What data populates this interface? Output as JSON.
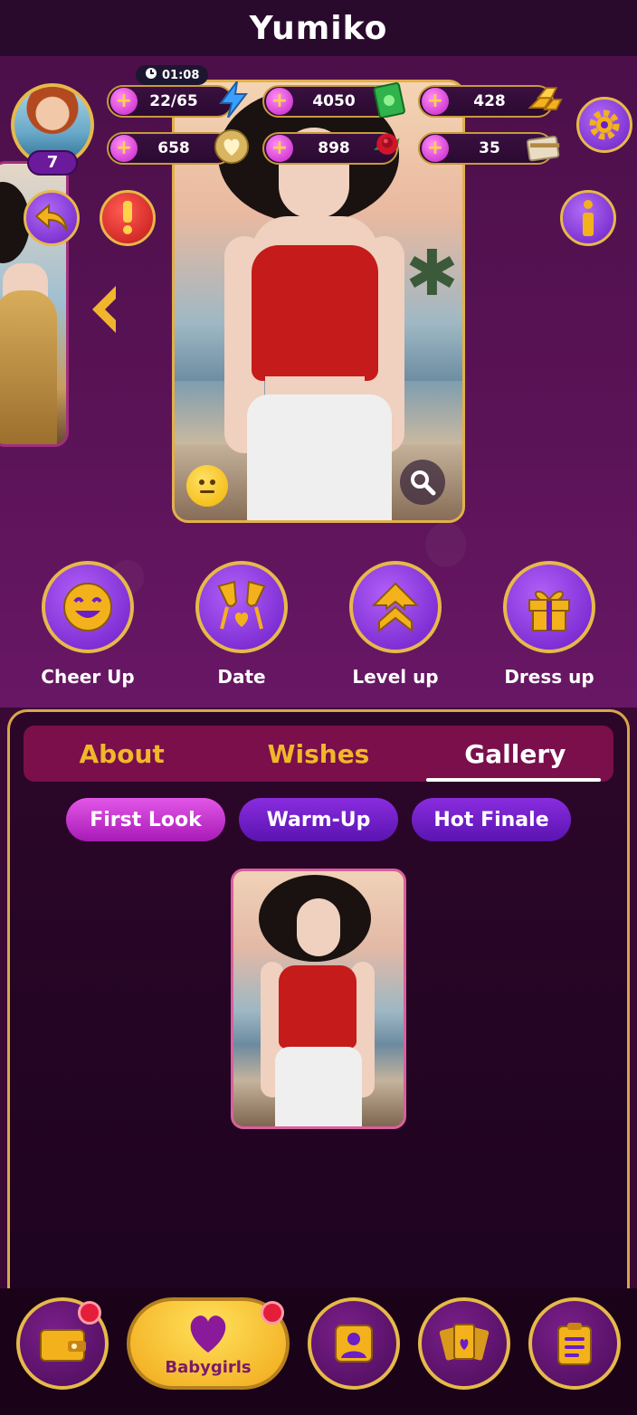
{
  "header": {
    "title": "Yumiko"
  },
  "player": {
    "level": "7",
    "timer": "01:08"
  },
  "resources": {
    "energy": {
      "value": "22/65",
      "icon": "lightning-icon"
    },
    "cash": {
      "value": "4050",
      "icon": "cash-icon"
    },
    "gold": {
      "value": "428",
      "icon": "gold-bars-icon"
    },
    "hearts": {
      "value": "658",
      "icon": "heart-coin-icon"
    },
    "roses": {
      "value": "898",
      "icon": "rose-icon"
    },
    "cards": {
      "value": "35",
      "icon": "card-icon"
    }
  },
  "actions": [
    {
      "label": "Cheer Up",
      "icon": "smile-icon"
    },
    {
      "label": "Date",
      "icon": "champagne-icon"
    },
    {
      "label": "Level up",
      "icon": "arrow-up-icon"
    },
    {
      "label": "Dress up",
      "icon": "gift-icon"
    }
  ],
  "tabs": [
    {
      "label": "About"
    },
    {
      "label": "Wishes"
    },
    {
      "label": "Gallery",
      "active": true
    }
  ],
  "chips": [
    {
      "label": "First Look"
    },
    {
      "label": "Warm-Up"
    },
    {
      "label": "Hot Finale"
    }
  ],
  "bottom_nav": {
    "main_label": "Babygirls"
  },
  "colors": {
    "accent_gold": "#e6b94a",
    "tab_active": "#ffffff",
    "tab_inactive": "#f1b72b",
    "badge": "#e41e3a"
  }
}
